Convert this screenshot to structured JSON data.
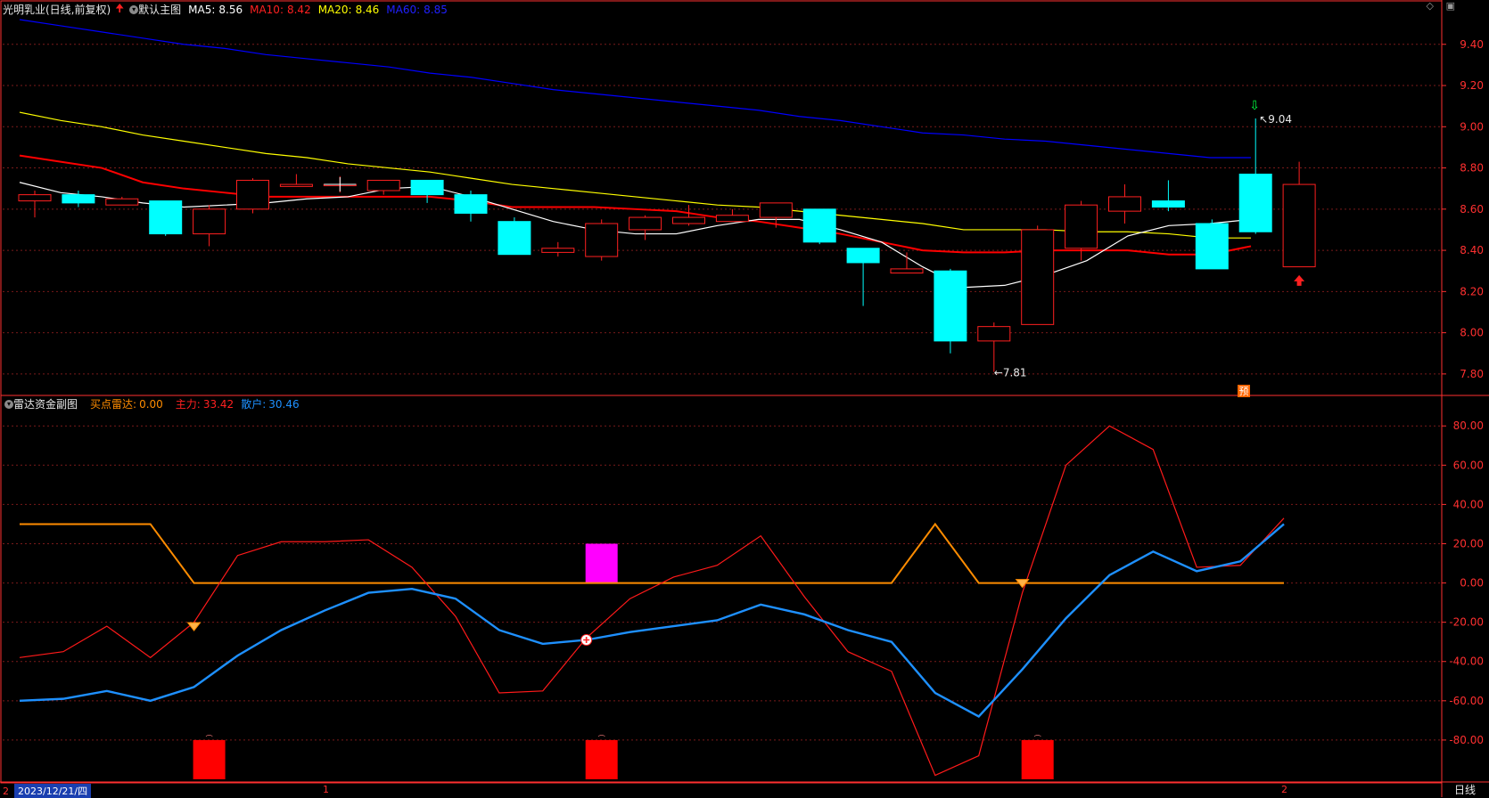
{
  "main_header": {
    "stock": "光明乳业(日线,前复权)",
    "template": "默认主图",
    "ma5_label": "MA5:",
    "ma5_value": "8.56",
    "ma10_label": "MA10:",
    "ma10_value": "8.42",
    "ma20_label": "MA20:",
    "ma20_value": "8.46",
    "ma60_label": "MA60:",
    "ma60_value": "8.85"
  },
  "sub_header": {
    "name": "雷达资金副图",
    "buy_label": "买点雷达:",
    "buy_value": "0.00",
    "main_label": "主力:",
    "main_value": "33.42",
    "retail_label": "散户:",
    "retail_value": "30.46"
  },
  "toolbar_icons": [
    "diamond-icon",
    "window-icon"
  ],
  "bottom_bar": {
    "date": "2023/12/21/四",
    "tick1": "1",
    "tick2": "2",
    "period": "日线",
    "left_marker": "2"
  },
  "colors": {
    "up": "#ff2020",
    "down": "#00ffff",
    "ma5": "#ffffff",
    "ma10": "#ff0000",
    "ma20": "#ffff00",
    "ma60": "#0000ff",
    "grid": "#7a1a1a",
    "axis": "#ff3030",
    "buy_radar": "#ff8c00",
    "main_force": "#ff1a1a",
    "retail": "#1e90ff",
    "magenta": "#ff00ff"
  },
  "chart_data": [
    {
      "type": "candlestick",
      "title": "光明乳业(日线,前复权)",
      "y_ticks": [
        7.8,
        8.0,
        8.2,
        8.4,
        8.6,
        8.8,
        9.0,
        9.2,
        9.4
      ],
      "ylim": [
        7.7,
        9.52
      ],
      "candles": [
        {
          "o": 8.64,
          "h": 8.69,
          "l": 8.56,
          "c": 8.67
        },
        {
          "o": 8.67,
          "h": 8.69,
          "l": 8.61,
          "c": 8.63
        },
        {
          "o": 8.62,
          "h": 8.66,
          "l": 8.62,
          "c": 8.65
        },
        {
          "o": 8.64,
          "h": 8.64,
          "l": 8.47,
          "c": 8.48
        },
        {
          "o": 8.48,
          "h": 8.62,
          "l": 8.42,
          "c": 8.6
        },
        {
          "o": 8.6,
          "h": 8.75,
          "l": 8.58,
          "c": 8.74
        },
        {
          "o": 8.71,
          "h": 8.77,
          "l": 8.71,
          "c": 8.72
        },
        {
          "o": 8.72,
          "h": 8.76,
          "l": 8.68,
          "c": 8.72
        },
        {
          "o": 8.69,
          "h": 8.74,
          "l": 8.67,
          "c": 8.74
        },
        {
          "o": 8.74,
          "h": 8.74,
          "l": 8.63,
          "c": 8.67
        },
        {
          "o": 8.67,
          "h": 8.69,
          "l": 8.54,
          "c": 8.58
        },
        {
          "o": 8.54,
          "h": 8.56,
          "l": 8.38,
          "c": 8.38
        },
        {
          "o": 8.39,
          "h": 8.44,
          "l": 8.37,
          "c": 8.41
        },
        {
          "o": 8.37,
          "h": 8.55,
          "l": 8.35,
          "c": 8.53
        },
        {
          "o": 8.5,
          "h": 8.57,
          "l": 8.45,
          "c": 8.56
        },
        {
          "o": 8.53,
          "h": 8.62,
          "l": 8.52,
          "c": 8.56
        },
        {
          "o": 8.54,
          "h": 8.6,
          "l": 8.54,
          "c": 8.57
        },
        {
          "o": 8.56,
          "h": 8.63,
          "l": 8.51,
          "c": 8.63
        },
        {
          "o": 8.6,
          "h": 8.6,
          "l": 8.43,
          "c": 8.44
        },
        {
          "o": 8.41,
          "h": 8.41,
          "l": 8.13,
          "c": 8.34
        },
        {
          "o": 8.29,
          "h": 8.39,
          "l": 8.29,
          "c": 8.31
        },
        {
          "o": 8.3,
          "h": 8.31,
          "l": 7.9,
          "c": 7.96
        },
        {
          "o": 7.96,
          "h": 8.05,
          "l": 7.81,
          "c": 8.03
        },
        {
          "o": 8.04,
          "h": 8.52,
          "l": 8.04,
          "c": 8.5
        },
        {
          "o": 8.41,
          "h": 8.64,
          "l": 8.35,
          "c": 8.62
        },
        {
          "o": 8.59,
          "h": 8.72,
          "l": 8.53,
          "c": 8.66
        },
        {
          "o": 8.64,
          "h": 8.74,
          "l": 8.59,
          "c": 8.61
        },
        {
          "o": 8.53,
          "h": 8.55,
          "l": 8.31,
          "c": 8.31
        },
        {
          "o": 8.77,
          "h": 9.04,
          "l": 8.48,
          "c": 8.49
        },
        {
          "o": 8.32,
          "h": 8.83,
          "l": 8.32,
          "c": 8.72
        }
      ],
      "ma5": [
        8.73,
        8.68,
        8.66,
        8.63,
        8.61,
        8.62,
        8.63,
        8.65,
        8.66,
        8.7,
        8.71,
        8.66,
        8.6,
        8.54,
        8.5,
        8.48,
        8.48,
        8.52,
        8.55,
        8.55,
        8.5,
        8.44,
        8.32,
        8.22,
        8.23,
        8.28,
        8.35,
        8.47,
        8.52,
        8.53,
        8.55
      ],
      "ma10": [
        8.86,
        8.83,
        8.8,
        8.73,
        8.7,
        8.68,
        8.66,
        8.66,
        8.66,
        8.66,
        8.66,
        8.64,
        8.61,
        8.61,
        8.61,
        8.6,
        8.59,
        8.56,
        8.54,
        8.51,
        8.48,
        8.44,
        8.4,
        8.39,
        8.39,
        8.4,
        8.4,
        8.4,
        8.38,
        8.38,
        8.42
      ],
      "ma20": [
        9.07,
        9.03,
        9.0,
        8.96,
        8.93,
        8.9,
        8.87,
        8.85,
        8.82,
        8.8,
        8.78,
        8.75,
        8.72,
        8.7,
        8.68,
        8.66,
        8.64,
        8.62,
        8.61,
        8.59,
        8.57,
        8.55,
        8.53,
        8.5,
        8.5,
        8.5,
        8.49,
        8.49,
        8.48,
        8.46,
        8.46
      ],
      "ma60": [
        9.52,
        9.49,
        9.46,
        9.43,
        9.4,
        9.38,
        9.35,
        9.33,
        9.31,
        9.29,
        9.26,
        9.24,
        9.21,
        9.18,
        9.16,
        9.14,
        9.12,
        9.1,
        9.08,
        9.05,
        9.03,
        9.0,
        8.97,
        8.96,
        8.94,
        8.93,
        8.91,
        8.89,
        8.87,
        8.85,
        8.85
      ],
      "labels": {
        "high": "9.04",
        "low": "7.81",
        "forecast": "预"
      }
    },
    {
      "type": "line",
      "title": "雷达资金副图",
      "y_ticks": [
        -80,
        -60,
        -40,
        -20,
        0,
        20,
        40,
        60,
        80
      ],
      "ylim": [
        -100,
        86
      ],
      "series": [
        {
          "name": "买点雷达",
          "values": [
            30,
            30,
            30,
            30,
            0,
            0,
            0,
            0,
            0,
            0,
            0,
            0,
            0,
            0,
            0,
            0,
            0,
            0,
            0,
            0,
            0,
            30,
            0,
            0,
            0,
            0,
            0,
            0,
            0,
            0
          ]
        },
        {
          "name": "主力",
          "values": [
            -38,
            -35,
            -22,
            -38,
            -20,
            14,
            21,
            21,
            22,
            8,
            -17,
            -56,
            -55,
            -28,
            -8,
            3,
            9,
            24,
            -7,
            -35,
            -45,
            -98,
            -88,
            -5,
            60,
            80,
            68,
            8,
            9,
            33
          ]
        },
        {
          "name": "散户",
          "values": [
            -60,
            -59,
            -55,
            -60,
            -53,
            -37,
            -24,
            -14,
            -5,
            -3,
            -8,
            -24,
            -31,
            -29,
            -25,
            -22,
            -19,
            -11,
            -16,
            -24,
            -30,
            -56,
            -68,
            -44,
            -18,
            4,
            16,
            6,
            11,
            30
          ]
        }
      ],
      "markers": [
        {
          "type": "magenta-bar",
          "index": 13,
          "value": 20
        },
        {
          "type": "red-bar",
          "index": 4,
          "value": -80
        },
        {
          "type": "red-bar",
          "index": 13,
          "value": -80
        },
        {
          "type": "red-bar",
          "index": 23,
          "value": -80
        }
      ]
    }
  ]
}
